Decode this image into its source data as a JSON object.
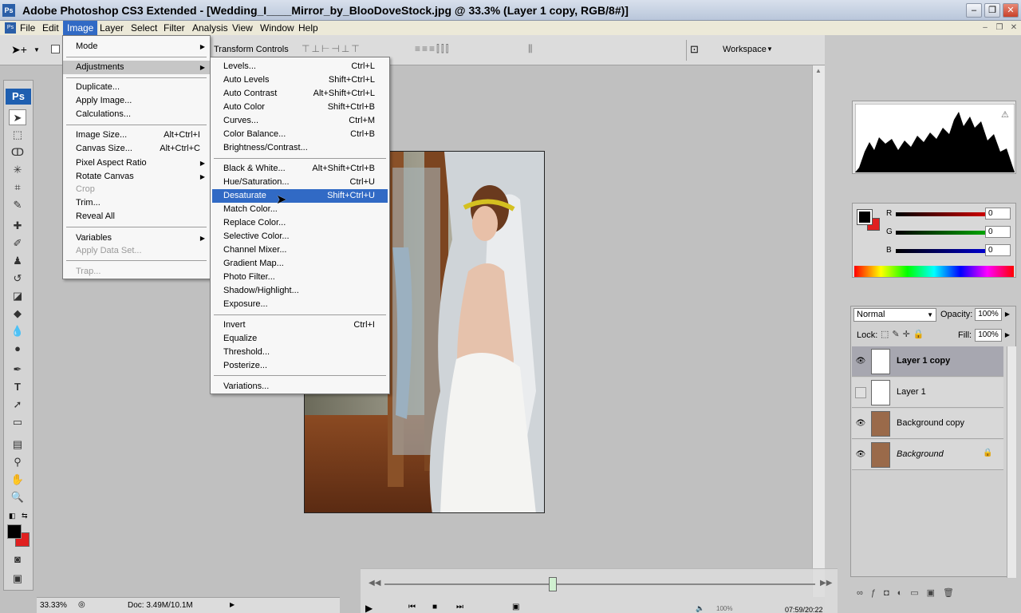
{
  "window": {
    "title": "Adobe Photoshop CS3 Extended - [Wedding_I____Mirror_by_BlooDoveStock.jpg @ 33.3% (Layer 1 copy, RGB/8#)]",
    "app_icon_text": "Ps",
    "minimize": "–",
    "maximize": "❐",
    "close": "✕"
  },
  "menubar": {
    "items": [
      "File",
      "Edit",
      "Image",
      "Layer",
      "Select",
      "Filter",
      "Analysis",
      "View",
      "Window",
      "Help"
    ],
    "active": "Image"
  },
  "options_bar": {
    "transform_controls": "Transform Controls",
    "workspace": "Workspace"
  },
  "toolbox": {
    "logo": "Ps"
  },
  "image_menu": {
    "items": [
      {
        "label": "Mode",
        "submenu": true
      },
      {
        "label": "Adjustments",
        "submenu": true
      },
      {
        "label": "Duplicate..."
      },
      {
        "label": "Apply Image..."
      },
      {
        "label": "Calculations..."
      },
      {
        "label": "Image Size...",
        "shortcut": "Alt+Ctrl+I"
      },
      {
        "label": "Canvas Size...",
        "shortcut": "Alt+Ctrl+C"
      },
      {
        "label": "Pixel Aspect Ratio",
        "submenu": true
      },
      {
        "label": "Rotate Canvas",
        "submenu": true
      },
      {
        "label": "Crop",
        "disabled": true
      },
      {
        "label": "Trim..."
      },
      {
        "label": "Reveal All"
      },
      {
        "label": "Variables",
        "submenu": true
      },
      {
        "label": "Apply Data Set...",
        "disabled": true
      },
      {
        "label": "Trap...",
        "disabled": true
      }
    ]
  },
  "adjustments_menu": {
    "items": [
      {
        "label": "Levels...",
        "shortcut": "Ctrl+L"
      },
      {
        "label": "Auto Levels",
        "shortcut": "Shift+Ctrl+L"
      },
      {
        "label": "Auto Contrast",
        "shortcut": "Alt+Shift+Ctrl+L"
      },
      {
        "label": "Auto Color",
        "shortcut": "Shift+Ctrl+B"
      },
      {
        "label": "Curves...",
        "shortcut": "Ctrl+M"
      },
      {
        "label": "Color Balance...",
        "shortcut": "Ctrl+B"
      },
      {
        "label": "Brightness/Contrast..."
      },
      {
        "label": "Black & White...",
        "shortcut": "Alt+Shift+Ctrl+B"
      },
      {
        "label": "Hue/Saturation...",
        "shortcut": "Ctrl+U"
      },
      {
        "label": "Desaturate",
        "shortcut": "Shift+Ctrl+U"
      },
      {
        "label": "Match Color..."
      },
      {
        "label": "Replace Color..."
      },
      {
        "label": "Selective Color..."
      },
      {
        "label": "Channel Mixer..."
      },
      {
        "label": "Gradient Map..."
      },
      {
        "label": "Photo Filter..."
      },
      {
        "label": "Shadow/Highlight..."
      },
      {
        "label": "Exposure..."
      },
      {
        "label": "Invert",
        "shortcut": "Ctrl+I"
      },
      {
        "label": "Equalize"
      },
      {
        "label": "Threshold..."
      },
      {
        "label": "Posterize..."
      },
      {
        "label": "Variations..."
      }
    ],
    "highlighted": "Desaturate"
  },
  "color_panel": {
    "r_label": "R",
    "g_label": "G",
    "b_label": "B",
    "r": "0",
    "g": "0",
    "b": "0"
  },
  "layers_panel": {
    "blend_mode": "Normal",
    "opacity_label": "Opacity:",
    "opacity": "100%",
    "lock_label": "Lock:",
    "fill_label": "Fill:",
    "fill": "100%",
    "layers": [
      {
        "name": "Layer 1 copy",
        "visible": true,
        "selected": true
      },
      {
        "name": "Layer 1",
        "visible": false
      },
      {
        "name": "Background copy",
        "visible": true
      },
      {
        "name": "Background",
        "visible": true,
        "locked": true
      }
    ]
  },
  "status_bar": {
    "zoom": "33.33%",
    "doc": "Doc: 3.49M/10.1M"
  },
  "animation": {
    "volume": "100%",
    "time": "07:59/20:22"
  },
  "colors": {
    "menu_highlight": "#316ac5",
    "foreground": "#000000",
    "background": "#e02020"
  }
}
